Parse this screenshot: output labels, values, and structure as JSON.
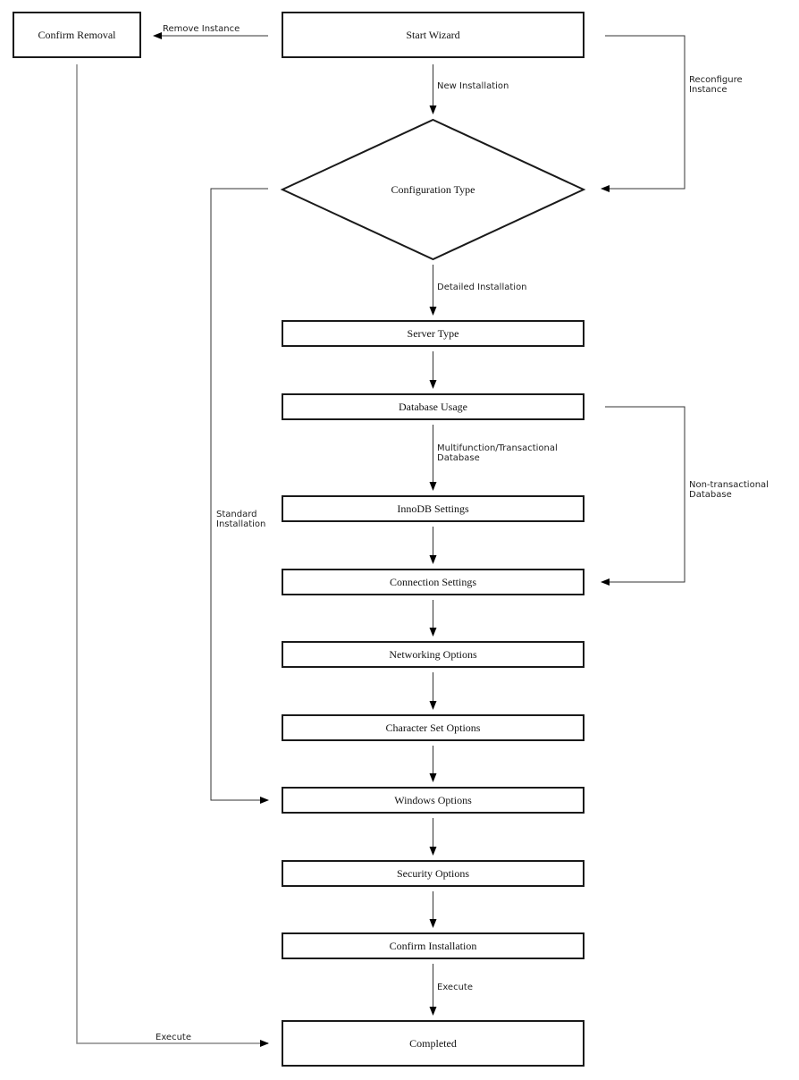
{
  "diagram": {
    "type": "flowchart",
    "nodes": [
      {
        "id": "confirm_removal",
        "label": "Confirm Removal",
        "shape": "rect"
      },
      {
        "id": "start_wizard",
        "label": "Start Wizard",
        "shape": "rect"
      },
      {
        "id": "configuration_type",
        "label": "Configuration Type",
        "shape": "diamond"
      },
      {
        "id": "server_type",
        "label": "Server Type",
        "shape": "rect"
      },
      {
        "id": "database_usage",
        "label": "Database Usage",
        "shape": "rect"
      },
      {
        "id": "innodb_settings",
        "label": "InnoDB Settings",
        "shape": "rect"
      },
      {
        "id": "connection_settings",
        "label": "Connection Settings",
        "shape": "rect"
      },
      {
        "id": "networking_options",
        "label": "Networking Options",
        "shape": "rect"
      },
      {
        "id": "character_set_options",
        "label": "Character Set Options",
        "shape": "rect"
      },
      {
        "id": "windows_options",
        "label": "Windows Options",
        "shape": "rect"
      },
      {
        "id": "security_options",
        "label": "Security Options",
        "shape": "rect"
      },
      {
        "id": "confirm_installation",
        "label": "Confirm Installation",
        "shape": "rect"
      },
      {
        "id": "completed",
        "label": "Completed",
        "shape": "rect"
      }
    ],
    "edges": [
      {
        "from": "start_wizard",
        "to": "confirm_removal",
        "label": [
          "Remove Instance"
        ]
      },
      {
        "from": "start_wizard",
        "to": "configuration_type",
        "label": [
          "New Installation"
        ]
      },
      {
        "from": "start_wizard",
        "to": "configuration_type",
        "label": [
          "Reconfigure",
          "Instance"
        ]
      },
      {
        "from": "configuration_type",
        "to": "server_type",
        "label": [
          "Detailed Installation"
        ]
      },
      {
        "from": "configuration_type",
        "to": "windows_options",
        "label": [
          "Standard",
          "Installation"
        ]
      },
      {
        "from": "server_type",
        "to": "database_usage",
        "label": []
      },
      {
        "from": "database_usage",
        "to": "innodb_settings",
        "label": [
          "Multifunction/Transactional",
          "Database"
        ]
      },
      {
        "from": "database_usage",
        "to": "connection_settings",
        "label": [
          "Non-transactional",
          "Database"
        ]
      },
      {
        "from": "innodb_settings",
        "to": "connection_settings",
        "label": []
      },
      {
        "from": "connection_settings",
        "to": "networking_options",
        "label": []
      },
      {
        "from": "networking_options",
        "to": "character_set_options",
        "label": []
      },
      {
        "from": "character_set_options",
        "to": "windows_options",
        "label": []
      },
      {
        "from": "windows_options",
        "to": "security_options",
        "label": []
      },
      {
        "from": "security_options",
        "to": "confirm_installation",
        "label": []
      },
      {
        "from": "confirm_installation",
        "to": "completed",
        "label": [
          "Execute"
        ]
      },
      {
        "from": "confirm_removal",
        "to": "completed",
        "label": [
          "Execute"
        ]
      }
    ]
  }
}
